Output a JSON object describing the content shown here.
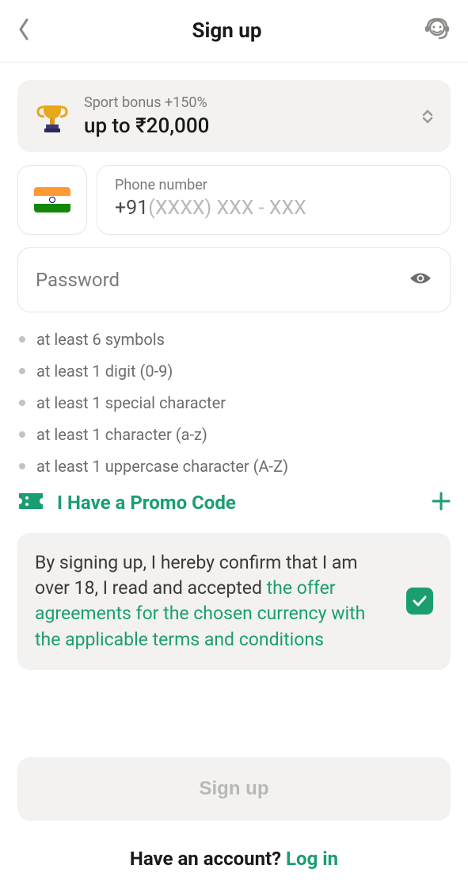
{
  "header": {
    "title": "Sign up"
  },
  "bonus": {
    "line1": "Sport bonus +150%",
    "line2": "up to ₹20,000"
  },
  "phone": {
    "label": "Phone number",
    "code": "+91",
    "mask": "(XXXX) XXX - XXX"
  },
  "password": {
    "placeholder": "Password"
  },
  "rules": {
    "r0": "at least 6 symbols",
    "r1": "at least 1 digit (0-9)",
    "r2": "at least 1 special character",
    "r3": "at least 1 character (a-z)",
    "r4": "at least 1 uppercase character (A-Z)"
  },
  "promo": {
    "text": "I Have a Promo Code"
  },
  "terms": {
    "prefix": "By signing up, I hereby confirm that I am over 18, I read and accepted ",
    "link": "the offer agreements for the chosen currency with the applicable terms and conditions"
  },
  "signup_btn": "Sign up",
  "login": {
    "prefix": "Have an account? ",
    "link": "Log in"
  }
}
